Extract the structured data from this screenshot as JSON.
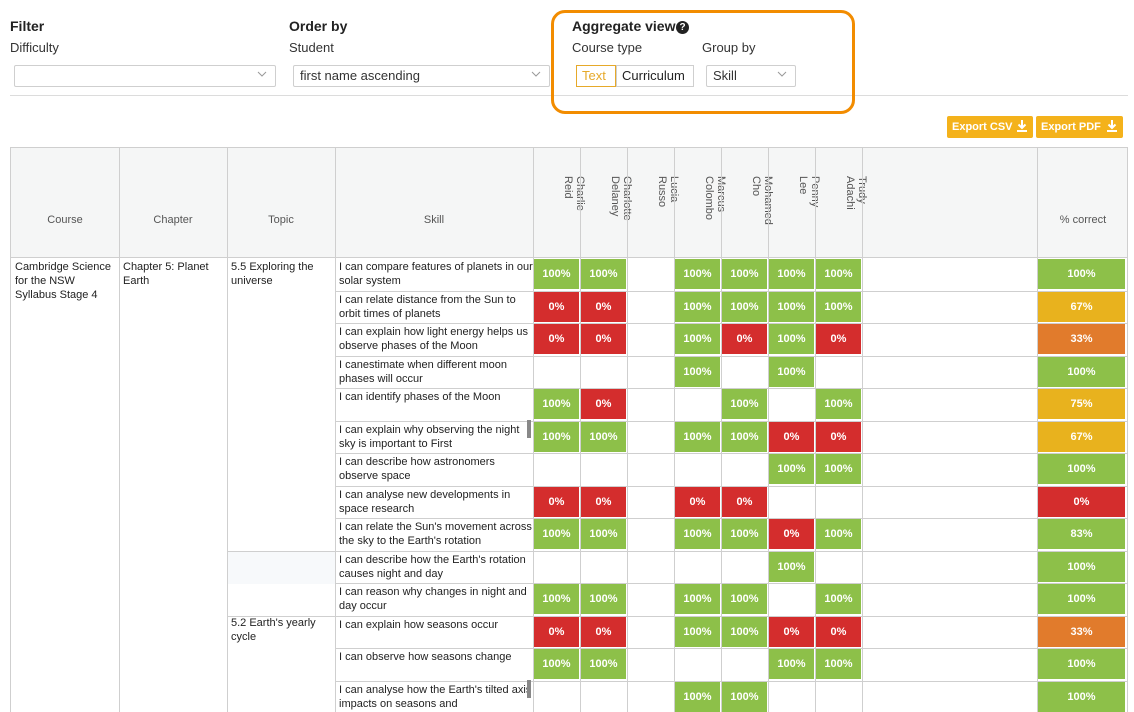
{
  "filter": {
    "title": "Filter",
    "difficulty_label": "Difficulty",
    "difficulty_value": ""
  },
  "order": {
    "title": "Order by",
    "student_label": "Student",
    "student_value": "first name ascending"
  },
  "aggregate": {
    "title": "Aggregate view",
    "help_icon": "question-circle-icon",
    "course_type_label": "Course type",
    "course_type_options": [
      "Text",
      "Curriculum"
    ],
    "course_type_selected": "Text",
    "group_by_label": "Group by",
    "group_by_value": "Skill",
    "highlight_color": "#f28c00"
  },
  "export": {
    "csv_label": "Export CSV",
    "pdf_label": "Export PDF",
    "icon": "download-icon",
    "color": "#f4b21b"
  },
  "table": {
    "headers": {
      "course": "Course",
      "chapter": "Chapter",
      "topic": "Topic",
      "skill": "Skill",
      "percent": "% correct"
    },
    "students": [
      "Charlie\nReid",
      "Charlotte\nDelaney",
      "Lucia\nRusso",
      "Marcus\nColombo",
      "Mohamed\nCho",
      "Penny\nLee",
      "Trudy\nAdachi"
    ],
    "course": "Cambridge Science for the NSW Syllabus Stage 4",
    "chapter": "Chapter 5: Planet Earth",
    "topics": [
      "5.5 Exploring the universe",
      "5.2 Earth's yearly cycle"
    ],
    "colors": {
      "green": "#8dc049",
      "red": "#d42d2d",
      "orange": "#e17b2c",
      "yellow": "#e8b21e"
    },
    "rows": [
      {
        "skill": "I can compare features of planets in our solar system",
        "scores": [
          "100%",
          "100%",
          "",
          "100%",
          "100%",
          "100%",
          "100%"
        ],
        "percent": "100%",
        "pct_color": "green"
      },
      {
        "skill": "I can relate distance from the Sun to orbit times of planets",
        "scores": [
          "0%",
          "0%",
          "",
          "100%",
          "100%",
          "100%",
          "100%"
        ],
        "percent": "67%",
        "pct_color": "yellow"
      },
      {
        "skill": "I can explain how light energy helps us observe phases of the Moon",
        "scores": [
          "0%",
          "0%",
          "",
          "100%",
          "0%",
          "100%",
          "0%"
        ],
        "percent": "33%",
        "pct_color": "orange"
      },
      {
        "skill": "I canestimate when different moon phases will occur",
        "scores": [
          "",
          "",
          "",
          "100%",
          "",
          "100%",
          ""
        ],
        "percent": "100%",
        "pct_color": "green"
      },
      {
        "skill": "I can identify phases of the Moon",
        "scores": [
          "100%",
          "0%",
          "",
          "",
          "100%",
          "",
          "100%"
        ],
        "percent": "75%",
        "pct_color": "yellow"
      },
      {
        "skill": "I can explain why observing the night sky is important to First",
        "scores": [
          "100%",
          "100%",
          "",
          "100%",
          "100%",
          "0%",
          "0%"
        ],
        "percent": "67%",
        "pct_color": "yellow"
      },
      {
        "skill": "I can describe how astronomers observe space",
        "scores": [
          "",
          "",
          "",
          "",
          "",
          "100%",
          "100%"
        ],
        "percent": "100%",
        "pct_color": "green"
      },
      {
        "skill": "I can analyse new developments in space research",
        "scores": [
          "0%",
          "0%",
          "",
          "0%",
          "0%",
          "",
          ""
        ],
        "percent": "0%",
        "pct_color": "red"
      },
      {
        "skill": "I can relate the Sun's movement across the sky to the Earth's rotation",
        "scores": [
          "100%",
          "100%",
          "",
          "100%",
          "100%",
          "0%",
          "100%"
        ],
        "percent": "83%",
        "pct_color": "green"
      },
      {
        "skill": "I can describe how the Earth's rotation causes night and day",
        "scores": [
          "",
          "",
          "",
          "",
          "",
          "100%",
          ""
        ],
        "percent": "100%",
        "pct_color": "green"
      },
      {
        "skill": "I can reason why changes in night and day occur",
        "scores": [
          "100%",
          "100%",
          "",
          "100%",
          "100%",
          "",
          "100%"
        ],
        "percent": "100%",
        "pct_color": "green"
      },
      {
        "skill": "I can explain how seasons occur",
        "scores": [
          "0%",
          "0%",
          "",
          "100%",
          "100%",
          "0%",
          "0%"
        ],
        "percent": "33%",
        "pct_color": "orange"
      },
      {
        "skill": "I can observe how seasons change",
        "scores": [
          "100%",
          "100%",
          "",
          "",
          "",
          "100%",
          "100%"
        ],
        "percent": "100%",
        "pct_color": "green"
      },
      {
        "skill": "I can analyse how the Earth's tilted axis impacts on seasons and",
        "scores": [
          "",
          "",
          "",
          "100%",
          "100%",
          "",
          ""
        ],
        "percent": "100%",
        "pct_color": "green"
      }
    ]
  }
}
